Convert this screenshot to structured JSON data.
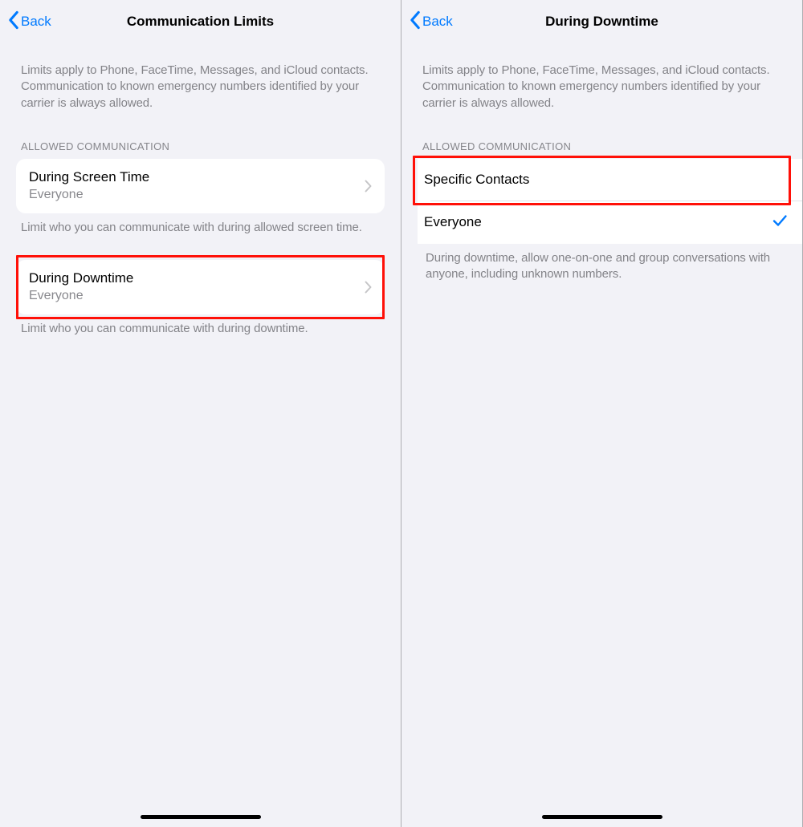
{
  "left": {
    "back_label": "Back",
    "title": "Communication Limits",
    "description": "Limits apply to Phone, FaceTime, Messages, and iCloud contacts. Communication to known emergency numbers identified by your carrier is always allowed.",
    "section_header": "ALLOWED COMMUNICATION",
    "rows": [
      {
        "title": "During Screen Time",
        "subtitle": "Everyone"
      },
      {
        "title": "During Downtime",
        "subtitle": "Everyone"
      }
    ],
    "footers": [
      "Limit who you can communicate with during allowed screen time.",
      "Limit who you can communicate with during downtime."
    ]
  },
  "right": {
    "back_label": "Back",
    "title": "During Downtime",
    "description": "Limits apply to Phone, FaceTime, Messages, and iCloud contacts. Communication to known emergency numbers identified by your carrier is always allowed.",
    "section_header": "ALLOWED COMMUNICATION",
    "options": [
      {
        "label": "Specific Contacts",
        "selected": false
      },
      {
        "label": "Everyone",
        "selected": true
      }
    ],
    "footer": "During downtime, allow one-on-one and group conversations with anyone, including unknown numbers."
  }
}
